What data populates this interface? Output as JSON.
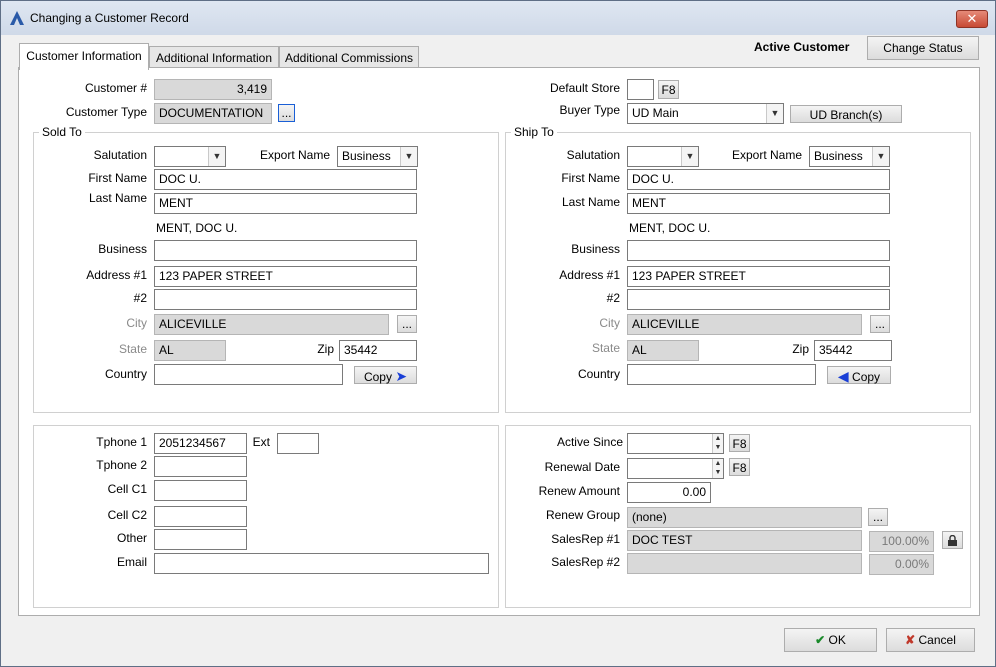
{
  "window": {
    "title": "Changing a Customer Record",
    "close_glyph": "✕"
  },
  "tabs": [
    {
      "label": "Customer Information",
      "active": true
    },
    {
      "label": "Additional Information",
      "active": false
    },
    {
      "label": "Additional Commissions",
      "active": false
    }
  ],
  "header": {
    "status_text": "Active Customer",
    "change_status_label": "Change Status"
  },
  "customer": {
    "number_label": "Customer #",
    "number": "3,419",
    "type_label": "Customer Type",
    "type": "DOCUMENTATION",
    "type_lookup": "...",
    "default_store_label": "Default Store",
    "default_store": "",
    "f8": "F8",
    "buyer_type_label": "Buyer Type",
    "buyer_type": "UD Main",
    "ud_branch_label": "UD Branch(s)"
  },
  "sold_to": {
    "title": "Sold To",
    "salutation_label": "Salutation",
    "salutation": "",
    "export_name_label": "Export Name",
    "export_name": "Business",
    "first_name_label": "First Name",
    "first_name": "DOC U.",
    "last_name_label": "Last Name",
    "last_name": "MENT",
    "full_name": "MENT, DOC U.",
    "business_label": "Business",
    "business": "",
    "address1_label": "Address #1",
    "address1": "123 PAPER STREET",
    "address2_label": "#2",
    "address2": "",
    "city_label": "City",
    "city": "ALICEVILLE",
    "city_lookup": "...",
    "state_label": "State",
    "state": "AL",
    "zip_label": "Zip",
    "zip": "35442",
    "country_label": "Country",
    "country": "",
    "copy_label": "Copy"
  },
  "ship_to": {
    "title": "Ship To",
    "salutation_label": "Salutation",
    "salutation": "",
    "export_name_label": "Export Name",
    "export_name": "Business",
    "first_name_label": "First Name",
    "first_name": "DOC U.",
    "last_name_label": "Last Name",
    "last_name": "MENT",
    "full_name": "MENT, DOC U.",
    "business_label": "Business",
    "business": "",
    "address1_label": "Address #1",
    "address1": "123 PAPER STREET",
    "address2_label": "#2",
    "address2": "",
    "city_label": "City",
    "city": "ALICEVILLE",
    "city_lookup": "...",
    "state_label": "State",
    "state": "AL",
    "zip_label": "Zip",
    "zip": "35442",
    "country_label": "Country",
    "country": "",
    "copy_label": "Copy"
  },
  "contact": {
    "phone1_label": "Tphone 1",
    "phone1": "2051234567",
    "ext_label": "Ext",
    "ext": "",
    "phone2_label": "Tphone 2",
    "phone2": "",
    "cell1_label": "Cell C1",
    "cell1": "",
    "cell2_label": "Cell C2",
    "cell2": "",
    "other_label": "Other",
    "other": "",
    "email_label": "Email",
    "email": ""
  },
  "membership": {
    "active_since_label": "Active Since",
    "active_since": "",
    "renewal_date_label": "Renewal Date",
    "renewal_date": "",
    "renew_amount_label": "Renew Amount",
    "renew_amount": "0.00",
    "renew_group_label": "Renew Group",
    "renew_group": "(none)",
    "renew_group_lookup": "...",
    "salesrep1_label": "SalesRep #1",
    "salesrep1": "DOC TEST",
    "salesrep1_pct": "100.00%",
    "salesrep2_label": "SalesRep #2",
    "salesrep2": "",
    "salesrep2_pct": "0.00%",
    "f8": "F8"
  },
  "footer": {
    "ok_label": "OK",
    "cancel_label": "Cancel"
  },
  "colors": {
    "accent": "#1a3fd6",
    "ok_green": "#1b8a2b",
    "cancel_red": "#c0392b"
  }
}
